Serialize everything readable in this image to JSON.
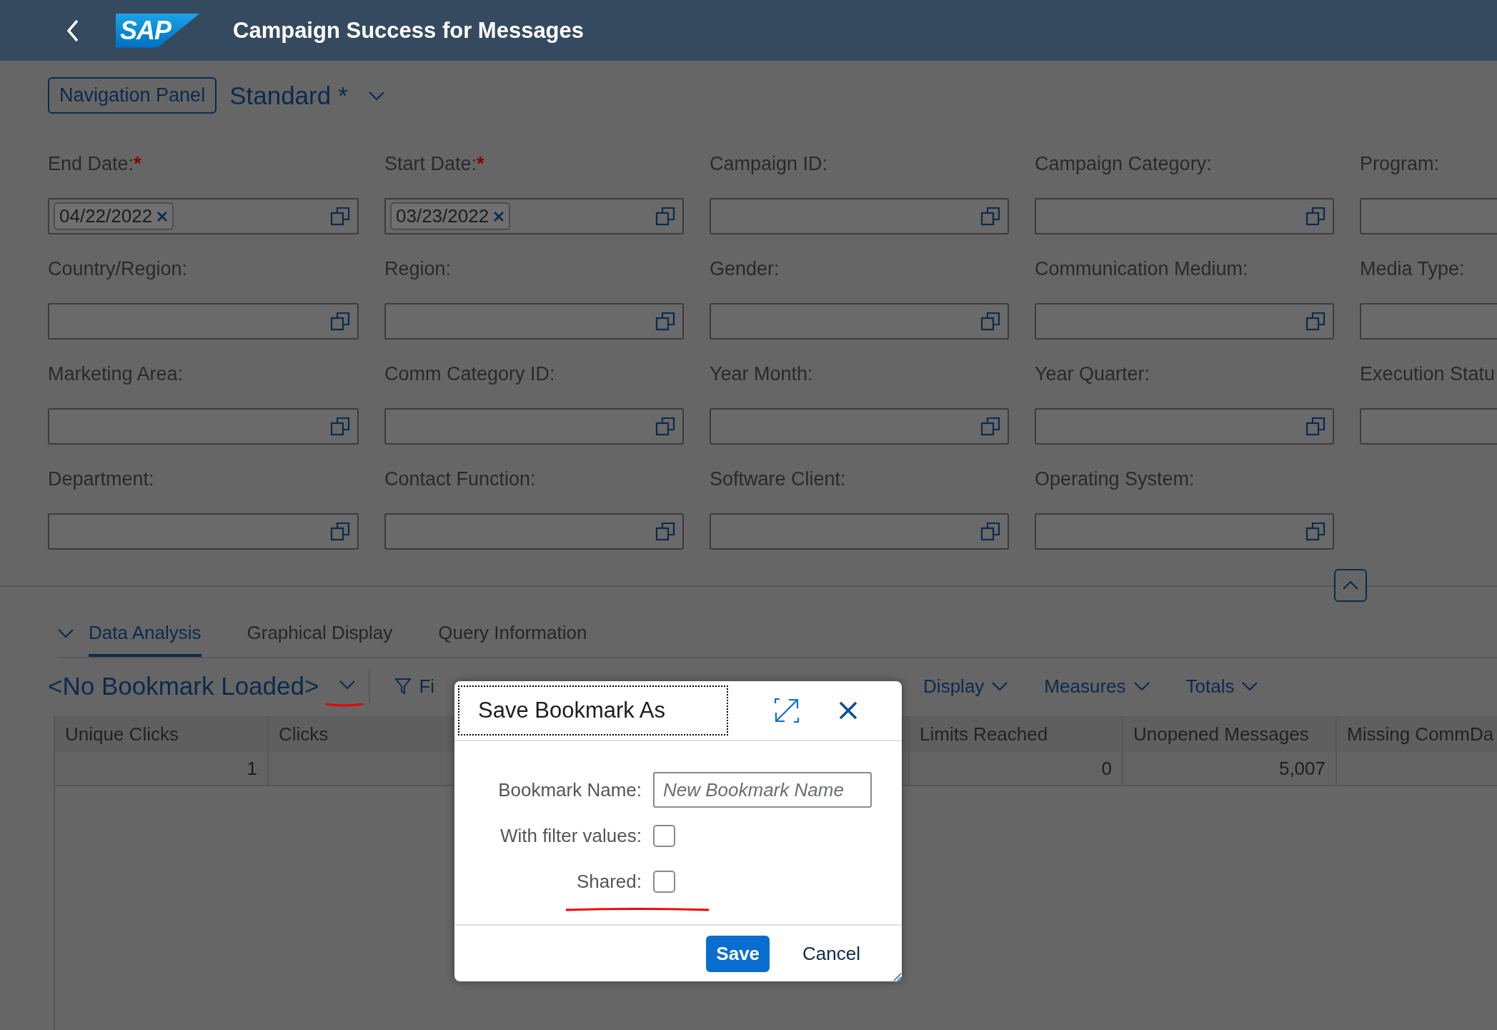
{
  "header": {
    "logo": "SAP",
    "title": "Campaign Success for Messages"
  },
  "variant": {
    "nav_button": "Navigation Panel",
    "name": "Standard *"
  },
  "filter_rows": [
    [
      {
        "label": "End Date:",
        "required_mark": "*",
        "token": "04/22/2022"
      },
      {
        "label": "Start Date:",
        "required_mark": "*",
        "token": "03/23/2022"
      },
      {
        "label": "Campaign ID:"
      },
      {
        "label": "Campaign Category:"
      },
      {
        "label": "Program:"
      }
    ],
    [
      {
        "label": "Country/Region:"
      },
      {
        "label": "Region:"
      },
      {
        "label": "Gender:"
      },
      {
        "label": "Communication Medium:"
      },
      {
        "label": "Media Type:"
      }
    ],
    [
      {
        "label": "Marketing Area:"
      },
      {
        "label": "Comm Category ID:"
      },
      {
        "label": "Year Month:"
      },
      {
        "label": "Year Quarter:"
      },
      {
        "label": "Execution Statu"
      }
    ],
    [
      {
        "label": "Department:"
      },
      {
        "label": "Contact Function:"
      },
      {
        "label": "Software Client:"
      },
      {
        "label": "Operating System:"
      }
    ]
  ],
  "tabs": [
    {
      "label": "Data Analysis",
      "selected": true
    },
    {
      "label": "Graphical Display",
      "selected": false
    },
    {
      "label": "Query Information",
      "selected": false
    }
  ],
  "toolbar": {
    "bookmark": "<No Bookmark Loaded>",
    "items": [
      {
        "label": "Fi",
        "kind": "filter"
      },
      {
        "label": "Display",
        "kind": "menu"
      },
      {
        "label": "Measures",
        "kind": "menu"
      },
      {
        "label": "Totals",
        "kind": "menu"
      }
    ]
  },
  "table": {
    "columns": [
      "Unique Clicks",
      "Clicks",
      "Limits Reached",
      "Unopened Messages",
      "Missing CommDa"
    ],
    "rows": [
      {
        "cells": [
          "1",
          null,
          "0",
          "5,007",
          null
        ]
      }
    ]
  },
  "dialog": {
    "title": "Save Bookmark As",
    "fields": [
      {
        "kind": "text",
        "label": "Bookmark Name:",
        "placeholder": "New Bookmark Name"
      },
      {
        "kind": "checkbox",
        "label": "With filter values:",
        "checked": false
      },
      {
        "kind": "checkbox",
        "label": "Shared:",
        "checked": false
      }
    ],
    "buttons": [
      {
        "label": "Save",
        "kind": "primary"
      },
      {
        "label": "Cancel",
        "kind": "transparent"
      }
    ]
  }
}
